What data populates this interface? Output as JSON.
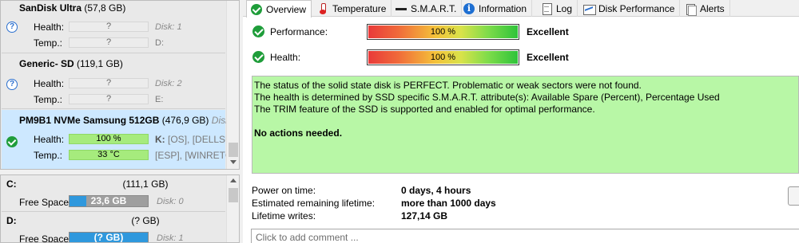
{
  "disks": [
    {
      "title_bold": "SanDisk Ultra",
      "title_size": "(57,8 GB)",
      "status": "unknown",
      "health_label": "Health:",
      "health_value": "?",
      "health_extra": "Disk: 1",
      "temp_label": "Temp.:",
      "temp_value": "?",
      "temp_extra": "D:"
    },
    {
      "title_bold": "Generic- SD",
      "title_size": "(119,1 GB)",
      "status": "unknown",
      "health_label": "Health:",
      "health_value": "?",
      "health_extra": "Disk: 2",
      "temp_label": "Temp.:",
      "temp_value": "?",
      "temp_extra": "E:"
    },
    {
      "title_bold": "PM9B1 NVMe Samsung 512GB",
      "title_size": "(476,9 GB)",
      "title_extra": "Disk",
      "status": "ok",
      "health_label": "Health:",
      "health_value": "100 %",
      "health_extra_bold": "K:",
      "health_extra": "[OS],  [DELLSU",
      "temp_label": "Temp.:",
      "temp_value": "33 °C",
      "temp_extra": "[ESP],  [WINRETC"
    }
  ],
  "volumes": [
    {
      "letter": "C:",
      "size": "(111,1 GB)",
      "label": "Free Space",
      "value": "23,6 GB",
      "fill_fraction": 0.21,
      "disk": "Disk: 0"
    },
    {
      "letter": "D:",
      "size": "(? GB)",
      "label": "Free Space",
      "value": "(? GB)",
      "fill_fraction": 1.0,
      "disk": "Disk: 1"
    }
  ],
  "tabs": [
    {
      "label": "Overview",
      "icon": "check-circle-icon",
      "active": true
    },
    {
      "label": "Temperature",
      "icon": "thermometer-icon"
    },
    {
      "label": "S.M.A.R.T.",
      "icon": "smart-icon"
    },
    {
      "label": "Information",
      "icon": "info-icon"
    },
    {
      "label": "Log",
      "icon": "log-icon"
    },
    {
      "label": "Disk Performance",
      "icon": "chart-icon"
    },
    {
      "label": "Alerts",
      "icon": "alerts-icon"
    }
  ],
  "metrics": [
    {
      "label": "Performance:",
      "value": "100 %",
      "fraction": 1.0,
      "result": "Excellent"
    },
    {
      "label": "Health:",
      "value": "100 %",
      "fraction": 1.0,
      "result": "Excellent"
    }
  ],
  "status_text": {
    "line1": "The status of the solid state disk is PERFECT. Problematic or weak sectors were not found.",
    "line2": "The health is determined by SSD specific S.M.A.R.T. attribute(s):  Available Spare (Percent), Percentage Used",
    "line3": "The TRIM feature of the SSD is supported and enabled for optimal performance.",
    "conclusion": "No actions needed."
  },
  "stats": [
    {
      "label": "Power on time:",
      "value": "0 days, 4 hours"
    },
    {
      "label": "Estimated remaining lifetime:",
      "value": "more than 1000 days"
    },
    {
      "label": "Lifetime writes:",
      "value": "127,14 GB"
    }
  ],
  "comment_placeholder": "Click to add comment ...",
  "colors": {
    "status_ok": "#1f9d3a",
    "status_box": "#b8f7a6",
    "selected_row": "#cde8ff",
    "volume_fill": "#2f98dd"
  }
}
